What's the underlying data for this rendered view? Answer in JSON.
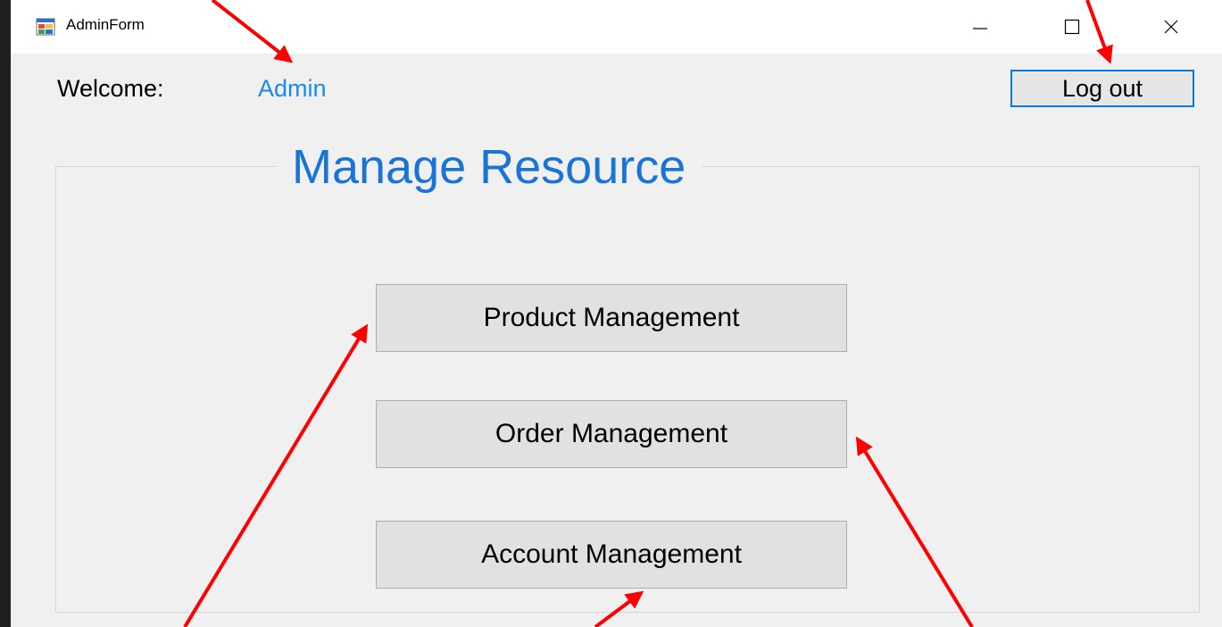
{
  "window": {
    "title": "AdminForm",
    "controls": {
      "minimize_icon": "minimize-icon",
      "maximize_icon": "maximize-icon",
      "close_icon": "close-icon"
    }
  },
  "header": {
    "welcome_label": "Welcome:",
    "user_name": "Admin",
    "logout_label": "Log out"
  },
  "group": {
    "title": "Manage Resource",
    "buttons": [
      {
        "label": "Product Management"
      },
      {
        "label": "Order Management"
      },
      {
        "label": "Account Management"
      }
    ]
  },
  "colors": {
    "accent_text": "#1e88e5",
    "group_title": "#1a73d6",
    "button_focus_border": "#0a78d7",
    "annotation_arrow": "#ff0000"
  }
}
